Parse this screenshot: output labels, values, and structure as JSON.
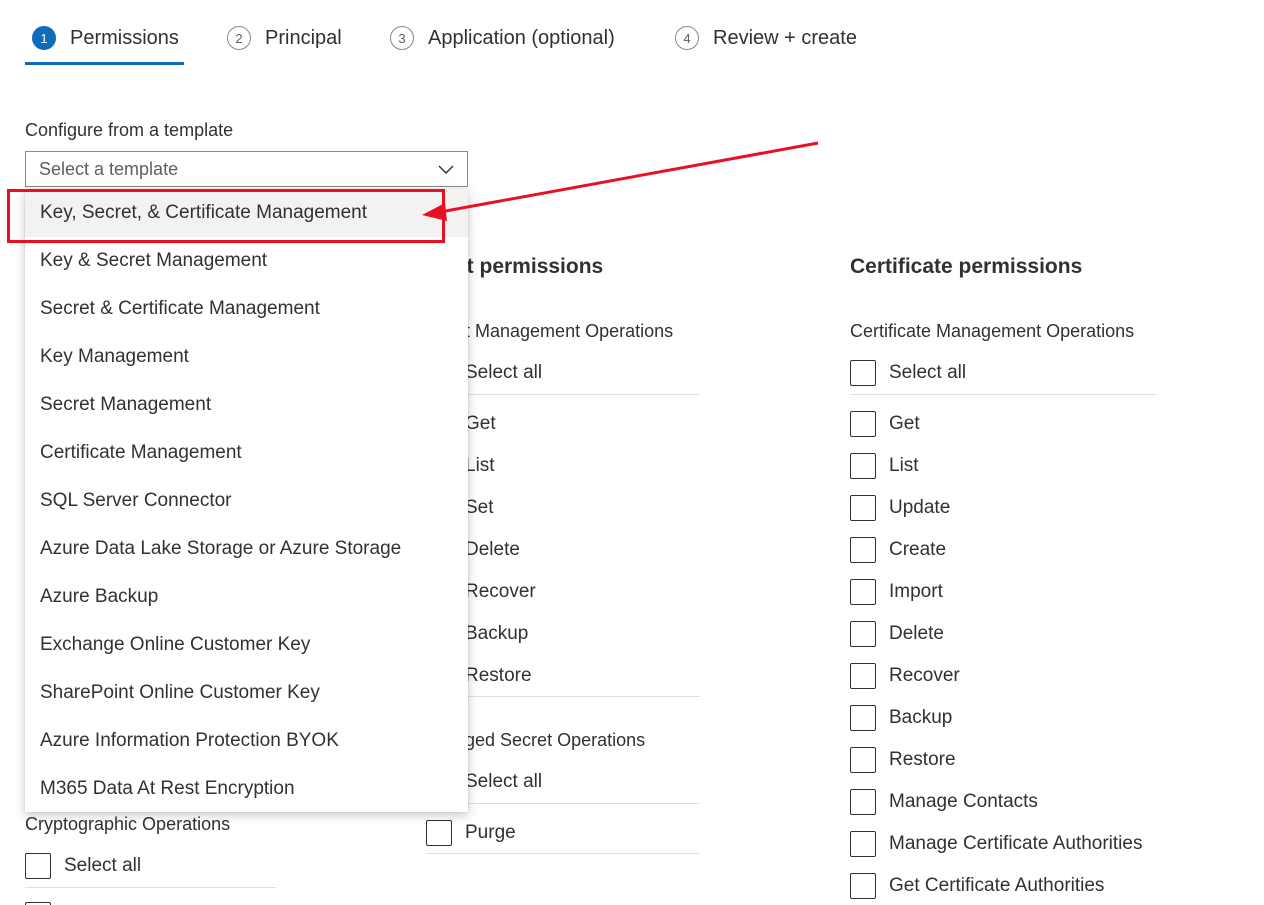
{
  "wizard": {
    "steps": [
      {
        "number": "1",
        "label": "Permissions",
        "active": true
      },
      {
        "number": "2",
        "label": "Principal"
      },
      {
        "number": "3",
        "label": "Application (optional)"
      },
      {
        "number": "4",
        "label": "Review + create"
      }
    ]
  },
  "template": {
    "label": "Configure from a template",
    "placeholder": "Select a template",
    "options": [
      "Key, Secret, & Certificate Management",
      "Key & Secret Management",
      "Secret & Certificate Management",
      "Key Management",
      "Secret Management",
      "Certificate Management",
      "SQL Server Connector",
      "Azure Data Lake Storage or Azure Storage",
      "Azure Backup",
      "Exchange Online Customer Key",
      "SharePoint Online Customer Key",
      "Azure Information Protection BYOK",
      "M365 Data At Rest Encryption"
    ]
  },
  "key_column": {
    "crypto_heading": "Cryptographic Operations",
    "select_all": "Select all"
  },
  "secret_column": {
    "heading": "et permissions",
    "management_heading": "et Management Operations",
    "select_all": "Select all",
    "items": [
      "Get",
      "List",
      "Set",
      "Delete",
      "Recover",
      "Backup",
      "Restore"
    ],
    "privileged_heading": "eged Secret Operations",
    "privileged_select_all": "Select all",
    "privileged_items": [
      "Purge"
    ]
  },
  "certificate_column": {
    "heading": "Certificate permissions",
    "management_heading": "Certificate Management Operations",
    "select_all": "Select all",
    "items": [
      "Get",
      "List",
      "Update",
      "Create",
      "Import",
      "Delete",
      "Recover",
      "Backup",
      "Restore",
      "Manage Contacts",
      "Manage Certificate Authorities",
      "Get Certificate Authorities"
    ]
  },
  "colors": {
    "accent": "#0f6cbd",
    "annotation": "#e81123"
  }
}
